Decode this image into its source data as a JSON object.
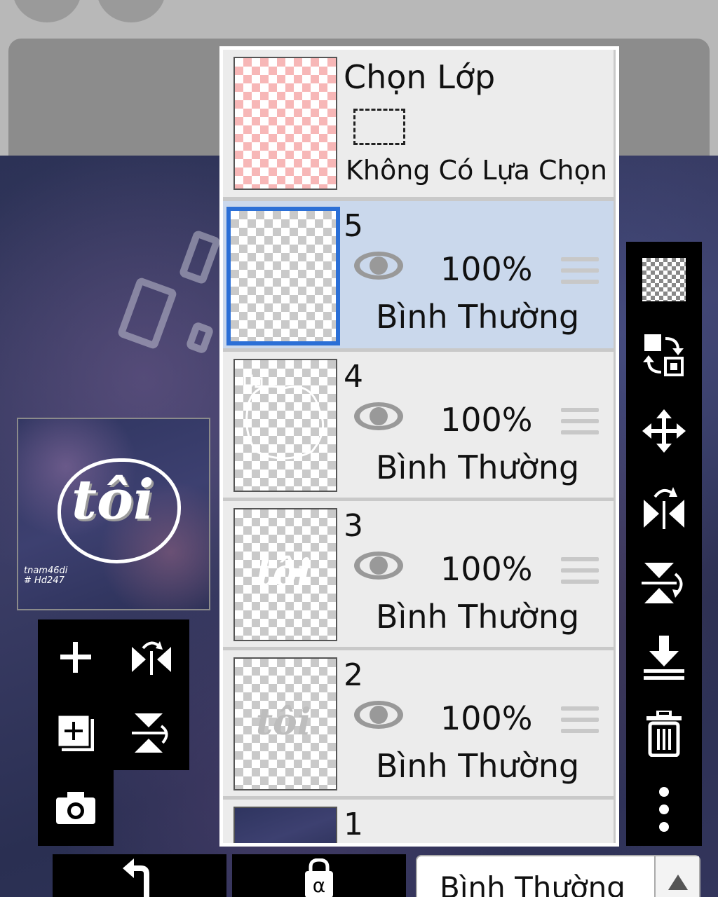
{
  "selection": {
    "title": "Chọn Lớp",
    "status": "Không Có Lựa Chọn"
  },
  "layers": [
    {
      "number": "5",
      "opacity": "100%",
      "blend": "Bình Thường",
      "selected": true
    },
    {
      "number": "4",
      "opacity": "100%",
      "blend": "Bình Thường",
      "selected": false
    },
    {
      "number": "3",
      "opacity": "100%",
      "blend": "Bình Thường",
      "selected": false
    },
    {
      "number": "2",
      "opacity": "100%",
      "blend": "Bình Thường",
      "selected": false
    },
    {
      "number": "1",
      "opacity": "",
      "blend": "",
      "selected": false
    }
  ],
  "preview": {
    "text": "tôi",
    "signature_line1": "tnam46di",
    "signature_line2": "# Hd247"
  },
  "thumbnail_text": "tôi",
  "blend_select": {
    "value": "Bình Thường"
  },
  "right_toolbar": [
    "transparency-icon",
    "swap-layers-icon",
    "move-icon",
    "flip-horizontal-icon",
    "flip-vertical-icon",
    "merge-down-icon",
    "delete-icon",
    "more-icon"
  ],
  "left_toolbar": [
    "add-layer-icon",
    "flip-horizontal-icon",
    "duplicate-layer-icon",
    "flip-vertical-icon",
    "camera-icon"
  ],
  "bottom_toolbar": [
    "undo-icon",
    "alpha-lock-icon"
  ],
  "colors": {
    "selected_row": "#cad8ec",
    "selected_border": "#2b6fd6",
    "row": "#ececec",
    "toolbar": "#000000"
  }
}
